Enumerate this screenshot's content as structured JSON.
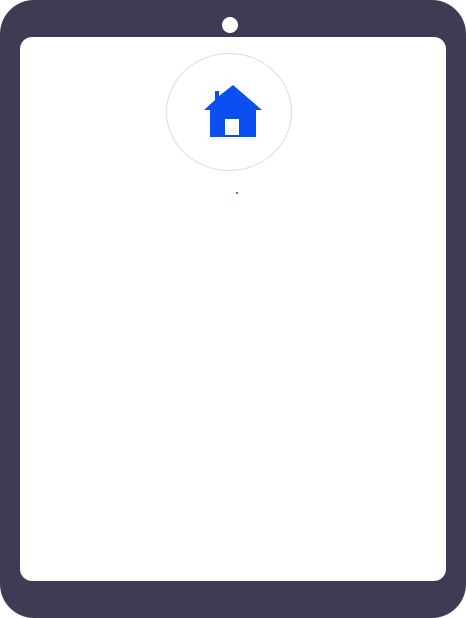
{
  "colors": {
    "frame": "#3f3b54",
    "screen": "#ffffff",
    "accent": "#0b4ff0",
    "circle_border": "#dcdcdc"
  },
  "device": {
    "type": "tablet"
  },
  "icons": {
    "main": "home-icon"
  }
}
